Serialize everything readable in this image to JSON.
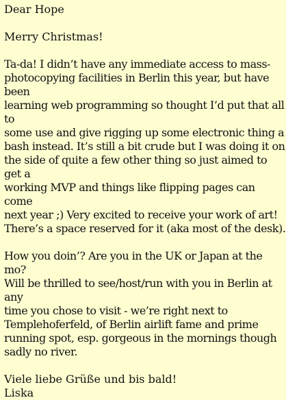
{
  "letter": {
    "salutation": "Dear Hope",
    "greeting": "Merry Christmas!",
    "paragraph1": "Ta-da! I didn’t have any immediate access to mass-\nphotocopying facilities in Berlin this year, but have been\nlearning web programming so thought I’d put that all to\nsome use and give rigging up some electronic thing a\nbash instead. It’s still a bit crude but I was doing it on\nthe side of quite a few other thing so just aimed to get a\nworking MVP and things like flipping pages can come\nnext year ;) Very excited to receive your work of art!\nThere’s a space reserved for it (aka most of the desk).",
    "paragraph2": "How you doin’? Are you in the UK or Japan at the mo?\nWill be thrilled to see/host/run with you in Berlin at any\ntime you chose to visit - we’re right next to\nTemplehoferfeld, of Berlin airlift fame and prime\nrunning spot, esp. gorgeous in the mornings though\nsadly no river.",
    "closing": "Viele liebe Grüße und bis bald!",
    "signature": "Liska"
  },
  "colors": {
    "background": "#fefed1",
    "text": "#111111"
  }
}
